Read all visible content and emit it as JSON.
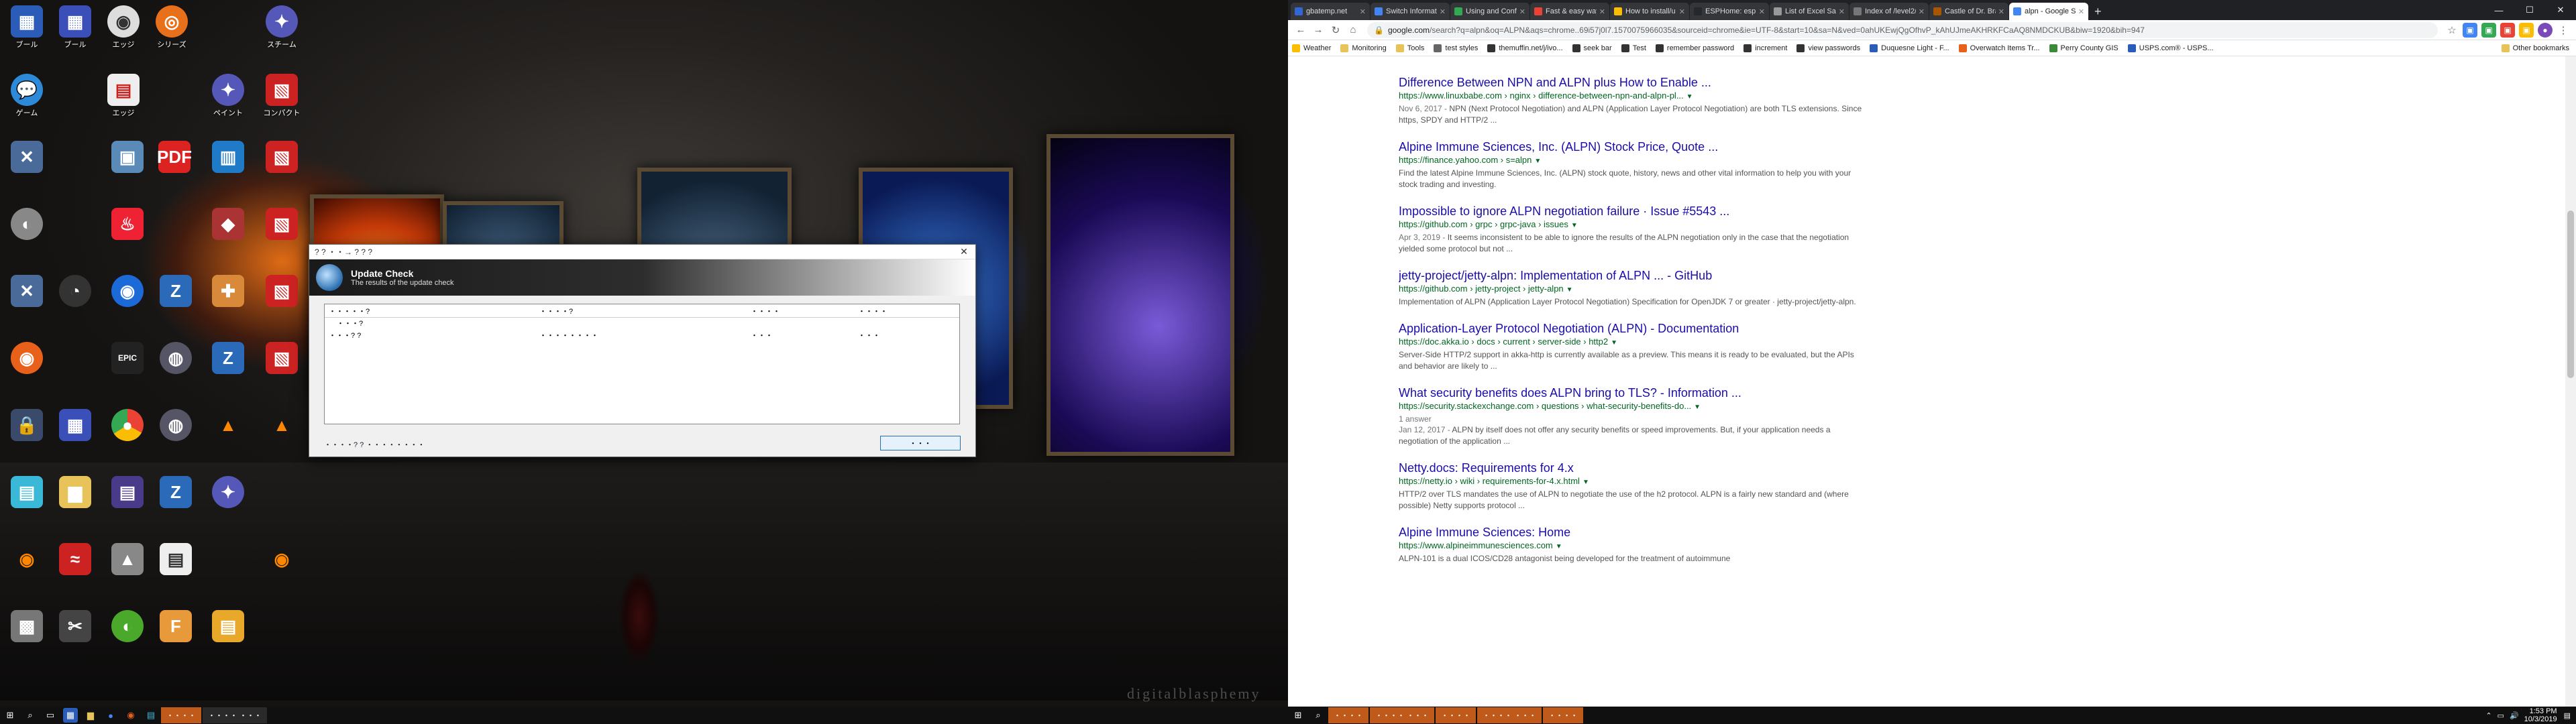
{
  "desktop": {
    "icons_col1": [
      "ブール",
      "ブール",
      "エッジ",
      "シリーズ",
      "スチーム",
      "ゲーム",
      "エッジ",
      "ペイント",
      "コンパクト"
    ],
    "watermark": "digitalblasphemy"
  },
  "dialog": {
    "title": "? ? ・・→ ? ? ?",
    "header_title": "Update Check",
    "header_subtitle": "The results of the update check",
    "col1": "・・・・・?",
    "col2": "・・・・?",
    "col3": "・・・・",
    "col4": "・・・・",
    "sub_row": "・・・?",
    "row_name": "・・・? ?",
    "row_current": "・・・・・・・・",
    "row_latest": "・・・",
    "row_status": "・・・",
    "footer_text": "・・・・? ? ・・・・・・・・",
    "close_label": "・・・"
  },
  "taskbar_left": {
    "app1": "・・・・",
    "app2": "・・・・ ・・・"
  },
  "browser": {
    "tabs": [
      {
        "label": "gbatemp.net",
        "color": "#3367d6"
      },
      {
        "label": "Switch Informatio",
        "color": "#4285f4"
      },
      {
        "label": "Using and Config",
        "color": "#34a853"
      },
      {
        "label": "Fast & easy way",
        "color": "#ea4335"
      },
      {
        "label": "How to install/u",
        "color": "#fbbc04"
      },
      {
        "label": "ESPHome: espho",
        "color": "#24292e"
      },
      {
        "label": "List of Excel Sage",
        "color": "#999999"
      },
      {
        "label": "Index of /level2/",
        "color": "#777777"
      },
      {
        "label": "Castle of Dr. Brain",
        "color": "#aa5500"
      },
      {
        "label": "alpn - Google Sear",
        "color": "#4285f4"
      }
    ],
    "new_tab": "+",
    "url_host": "google.com",
    "url_rest": "/search?q=alpn&oq=ALPN&aqs=chrome..69i57j0l7.1570075966035&sourceid=chrome&ie=UTF-8&start=10&sa=N&ved=0ahUKEwjQgOfhvP_kAhUJmeAKHRKFCaAQ8NMDCKUB&biw=1920&bih=947",
    "bookmarks": [
      "Weather",
      "Monitoring",
      "Tools",
      "test styles",
      "themuffin.net/j/ivo...",
      "seek bar",
      "Test",
      "remember password",
      "increment",
      "view passwords",
      "Duquesne Light - F...",
      "Overwatch Items Tr...",
      "Perry County GIS",
      "USPS.com® - USPS..."
    ],
    "other_bookmarks": "Other bookmarks"
  },
  "results": [
    {
      "title": "Difference Between NPN and ALPN plus How to Enable ...",
      "url": "https://www.linuxbabe.com › nginx › difference-between-npn-and-alpn-pl...",
      "date": "Nov 6, 2017 - ",
      "snippet": "NPN (Next Protocol Negotiation) and ALPN (Application Layer Protocol Negotiation) are both TLS extensions. Since https, SPDY and HTTP/2 ...",
      "extra": ""
    },
    {
      "title": "Alpine Immune Sciences, Inc. (ALPN) Stock Price, Quote ...",
      "url": "https://finance.yahoo.com › s=alpn",
      "date": "",
      "snippet": "Find the latest Alpine Immune Sciences, Inc. (ALPN) stock quote, history, news and other vital information to help you with your stock trading and investing.",
      "extra": ""
    },
    {
      "title": "Impossible to ignore ALPN negotiation failure · Issue #5543 ...",
      "url": "https://github.com › grpc › grpc-java › issues",
      "date": "Apr 3, 2019 - ",
      "snippet": "It seems inconsistent to be able to ignore the results of the ALPN negotiation only in the case that the negotiation yielded some protocol but not ...",
      "extra": ""
    },
    {
      "title": "jetty-project/jetty-alpn: Implementation of ALPN ... - GitHub",
      "url": "https://github.com › jetty-project › jetty-alpn",
      "date": "",
      "snippet": "Implementation of ALPN (Application Layer Protocol Negotiation) Specification for OpenJDK 7 or greater · jetty-project/jetty-alpn.",
      "extra": ""
    },
    {
      "title": "Application-Layer Protocol Negotiation (ALPN) - Documentation",
      "url": "https://doc.akka.io › docs › current › server-side › http2",
      "date": "",
      "snippet": "Server-Side HTTP/2 support in akka-http is currently available as a preview. This means it is ready to be evaluated, but the APIs and behavior are likely to ...",
      "extra": ""
    },
    {
      "title": "What security benefits does ALPN bring to TLS? - Information ...",
      "url": "https://security.stackexchange.com › questions › what-security-benefits-do...",
      "date": "Jan 12, 2017 - ",
      "snippet": "ALPN by itself does not offer any security benefits or speed improvements. But, if your application needs a negotiation of the application ...",
      "extra": "1 answer"
    },
    {
      "title": "Netty.docs: Requirements for 4.x",
      "url": "https://netty.io › wiki › requirements-for-4.x.html",
      "date": "",
      "snippet": "HTTP/2 over TLS mandates the use of ALPN to negotiate the use of the h2 protocol. ALPN is a fairly new standard and (where possible) Netty supports protocol ...",
      "extra": ""
    },
    {
      "title": "Alpine Immune Sciences: Home",
      "url": "https://www.alpineimmunesciences.com",
      "date": "",
      "snippet": "ALPN-101 is a dual ICOS/CD28 antagonist being developed for the treatment of autoimmune",
      "extra": ""
    }
  ],
  "taskbar_right": {
    "clock_time": "1:53 PM",
    "clock_date": "10/3/2019"
  }
}
